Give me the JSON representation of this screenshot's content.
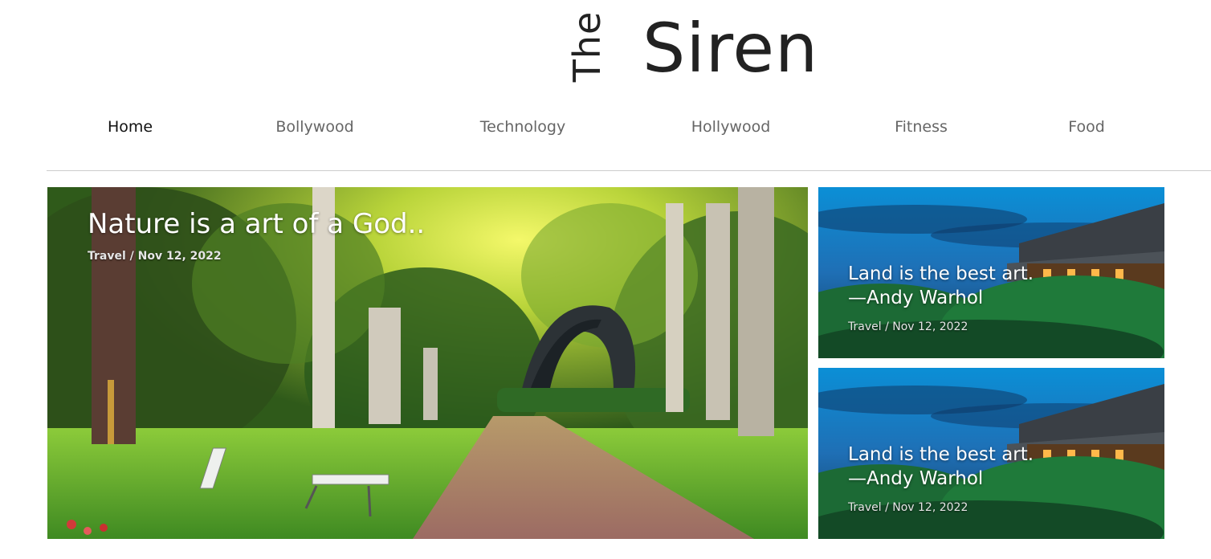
{
  "logo": {
    "the": "The",
    "siren": "Siren"
  },
  "nav": {
    "items": [
      {
        "label": "Home"
      },
      {
        "label": "Bollywood"
      },
      {
        "label": "Technology"
      },
      {
        "label": "Hollywood"
      },
      {
        "label": "Fitness"
      },
      {
        "label": "Food"
      }
    ],
    "active": "Home"
  },
  "hero": {
    "title": "Nature is a art of a God..",
    "category": "Travel",
    "date": "Nov 12, 2022",
    "meta": "Travel / Nov 12, 2022",
    "image": "park-path-illustration"
  },
  "side_posts": [
    {
      "title_line1": "Land is the best art.",
      "title_line2": "—Andy Warhol",
      "meta": "Travel / Nov 12, 2022",
      "image": "pagoda-night-illustration"
    },
    {
      "title_line1": "Land is the best art.",
      "title_line2": "—Andy Warhol",
      "meta": "Travel / Nov 12, 2022",
      "image": "pagoda-night-illustration"
    }
  ],
  "colors": {
    "text_dark": "#222222",
    "nav_text": "#666666",
    "divider": "#cccccc"
  }
}
